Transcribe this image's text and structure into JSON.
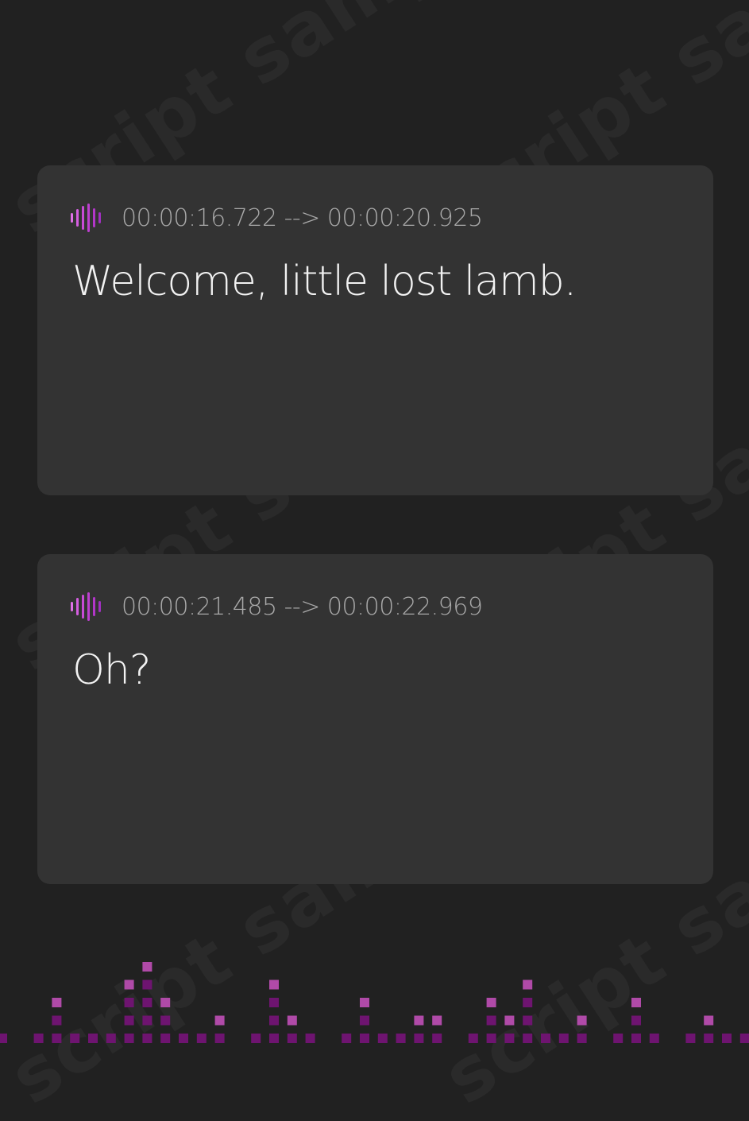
{
  "watermark": {
    "text": "script sample"
  },
  "cues": [
    {
      "timing": "00:00:16.722 --> 00:00:20.925",
      "text": "Welcome, little lost lamb."
    },
    {
      "timing": "00:00:21.485 --> 00:00:22.969",
      "text": "Oh?"
    }
  ],
  "icons": {
    "cue_icon": "audio-waveform-icon"
  },
  "colors": {
    "background": "#212121",
    "card": "#333333",
    "timestamp": "#a9a9a9",
    "cue_text": "#f2f2f2",
    "accent_light": "#e070e8",
    "accent_dark": "#a030c0",
    "equalizer_light": "#b04aa8",
    "equalizer_dark": "#6e1470"
  },
  "equalizer": {
    "levels": [
      1,
      0,
      1,
      3,
      1,
      1,
      1,
      4,
      5,
      3,
      1,
      1,
      2,
      0,
      1,
      4,
      2,
      1,
      0,
      1,
      3,
      1,
      1,
      2,
      2,
      0,
      1,
      3,
      2,
      4,
      1,
      1,
      2,
      0,
      1,
      3,
      1,
      0,
      1,
      2,
      1,
      1,
      3,
      1,
      0,
      1,
      1,
      2,
      1,
      1,
      1,
      1,
      4,
      2,
      5,
      3,
      1,
      1,
      2,
      1,
      1,
      0,
      2,
      1,
      0,
      1,
      1,
      0,
      1
    ]
  }
}
